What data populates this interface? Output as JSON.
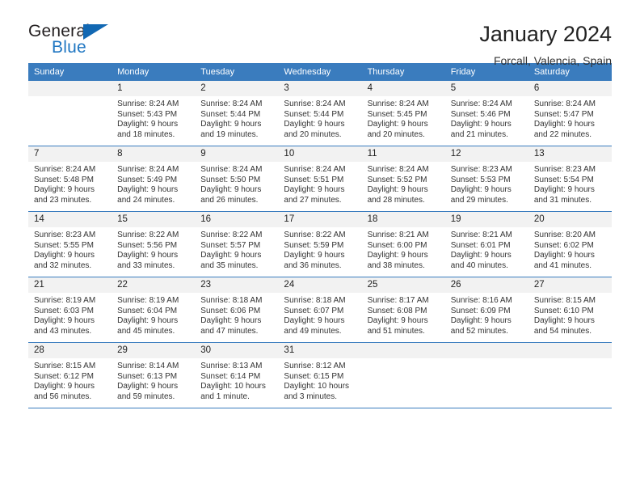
{
  "brand": {
    "name_part1": "General",
    "name_part2": "Blue",
    "flag_icon": "triangle-flag-icon"
  },
  "header": {
    "title": "January 2024",
    "subtitle": "Forcall, Valencia, Spain"
  },
  "colors": {
    "header_blue": "#3a7cbe",
    "brand_blue": "#1f76c2",
    "daynum_bg": "#f2f2f2",
    "text": "#333333"
  },
  "weekday_headers": [
    "Sunday",
    "Monday",
    "Tuesday",
    "Wednesday",
    "Thursday",
    "Friday",
    "Saturday"
  ],
  "weeks": [
    [
      {
        "day": "",
        "empty": true
      },
      {
        "day": "1",
        "sunrise": "Sunrise: 8:24 AM",
        "sunset": "Sunset: 5:43 PM",
        "daylight1": "Daylight: 9 hours",
        "daylight2": "and 18 minutes."
      },
      {
        "day": "2",
        "sunrise": "Sunrise: 8:24 AM",
        "sunset": "Sunset: 5:44 PM",
        "daylight1": "Daylight: 9 hours",
        "daylight2": "and 19 minutes."
      },
      {
        "day": "3",
        "sunrise": "Sunrise: 8:24 AM",
        "sunset": "Sunset: 5:44 PM",
        "daylight1": "Daylight: 9 hours",
        "daylight2": "and 20 minutes."
      },
      {
        "day": "4",
        "sunrise": "Sunrise: 8:24 AM",
        "sunset": "Sunset: 5:45 PM",
        "daylight1": "Daylight: 9 hours",
        "daylight2": "and 20 minutes."
      },
      {
        "day": "5",
        "sunrise": "Sunrise: 8:24 AM",
        "sunset": "Sunset: 5:46 PM",
        "daylight1": "Daylight: 9 hours",
        "daylight2": "and 21 minutes."
      },
      {
        "day": "6",
        "sunrise": "Sunrise: 8:24 AM",
        "sunset": "Sunset: 5:47 PM",
        "daylight1": "Daylight: 9 hours",
        "daylight2": "and 22 minutes."
      }
    ],
    [
      {
        "day": "7",
        "sunrise": "Sunrise: 8:24 AM",
        "sunset": "Sunset: 5:48 PM",
        "daylight1": "Daylight: 9 hours",
        "daylight2": "and 23 minutes."
      },
      {
        "day": "8",
        "sunrise": "Sunrise: 8:24 AM",
        "sunset": "Sunset: 5:49 PM",
        "daylight1": "Daylight: 9 hours",
        "daylight2": "and 24 minutes."
      },
      {
        "day": "9",
        "sunrise": "Sunrise: 8:24 AM",
        "sunset": "Sunset: 5:50 PM",
        "daylight1": "Daylight: 9 hours",
        "daylight2": "and 26 minutes."
      },
      {
        "day": "10",
        "sunrise": "Sunrise: 8:24 AM",
        "sunset": "Sunset: 5:51 PM",
        "daylight1": "Daylight: 9 hours",
        "daylight2": "and 27 minutes."
      },
      {
        "day": "11",
        "sunrise": "Sunrise: 8:24 AM",
        "sunset": "Sunset: 5:52 PM",
        "daylight1": "Daylight: 9 hours",
        "daylight2": "and 28 minutes."
      },
      {
        "day": "12",
        "sunrise": "Sunrise: 8:23 AM",
        "sunset": "Sunset: 5:53 PM",
        "daylight1": "Daylight: 9 hours",
        "daylight2": "and 29 minutes."
      },
      {
        "day": "13",
        "sunrise": "Sunrise: 8:23 AM",
        "sunset": "Sunset: 5:54 PM",
        "daylight1": "Daylight: 9 hours",
        "daylight2": "and 31 minutes."
      }
    ],
    [
      {
        "day": "14",
        "sunrise": "Sunrise: 8:23 AM",
        "sunset": "Sunset: 5:55 PM",
        "daylight1": "Daylight: 9 hours",
        "daylight2": "and 32 minutes."
      },
      {
        "day": "15",
        "sunrise": "Sunrise: 8:22 AM",
        "sunset": "Sunset: 5:56 PM",
        "daylight1": "Daylight: 9 hours",
        "daylight2": "and 33 minutes."
      },
      {
        "day": "16",
        "sunrise": "Sunrise: 8:22 AM",
        "sunset": "Sunset: 5:57 PM",
        "daylight1": "Daylight: 9 hours",
        "daylight2": "and 35 minutes."
      },
      {
        "day": "17",
        "sunrise": "Sunrise: 8:22 AM",
        "sunset": "Sunset: 5:59 PM",
        "daylight1": "Daylight: 9 hours",
        "daylight2": "and 36 minutes."
      },
      {
        "day": "18",
        "sunrise": "Sunrise: 8:21 AM",
        "sunset": "Sunset: 6:00 PM",
        "daylight1": "Daylight: 9 hours",
        "daylight2": "and 38 minutes."
      },
      {
        "day": "19",
        "sunrise": "Sunrise: 8:21 AM",
        "sunset": "Sunset: 6:01 PM",
        "daylight1": "Daylight: 9 hours",
        "daylight2": "and 40 minutes."
      },
      {
        "day": "20",
        "sunrise": "Sunrise: 8:20 AM",
        "sunset": "Sunset: 6:02 PM",
        "daylight1": "Daylight: 9 hours",
        "daylight2": "and 41 minutes."
      }
    ],
    [
      {
        "day": "21",
        "sunrise": "Sunrise: 8:19 AM",
        "sunset": "Sunset: 6:03 PM",
        "daylight1": "Daylight: 9 hours",
        "daylight2": "and 43 minutes."
      },
      {
        "day": "22",
        "sunrise": "Sunrise: 8:19 AM",
        "sunset": "Sunset: 6:04 PM",
        "daylight1": "Daylight: 9 hours",
        "daylight2": "and 45 minutes."
      },
      {
        "day": "23",
        "sunrise": "Sunrise: 8:18 AM",
        "sunset": "Sunset: 6:06 PM",
        "daylight1": "Daylight: 9 hours",
        "daylight2": "and 47 minutes."
      },
      {
        "day": "24",
        "sunrise": "Sunrise: 8:18 AM",
        "sunset": "Sunset: 6:07 PM",
        "daylight1": "Daylight: 9 hours",
        "daylight2": "and 49 minutes."
      },
      {
        "day": "25",
        "sunrise": "Sunrise: 8:17 AM",
        "sunset": "Sunset: 6:08 PM",
        "daylight1": "Daylight: 9 hours",
        "daylight2": "and 51 minutes."
      },
      {
        "day": "26",
        "sunrise": "Sunrise: 8:16 AM",
        "sunset": "Sunset: 6:09 PM",
        "daylight1": "Daylight: 9 hours",
        "daylight2": "and 52 minutes."
      },
      {
        "day": "27",
        "sunrise": "Sunrise: 8:15 AM",
        "sunset": "Sunset: 6:10 PM",
        "daylight1": "Daylight: 9 hours",
        "daylight2": "and 54 minutes."
      }
    ],
    [
      {
        "day": "28",
        "sunrise": "Sunrise: 8:15 AM",
        "sunset": "Sunset: 6:12 PM",
        "daylight1": "Daylight: 9 hours",
        "daylight2": "and 56 minutes."
      },
      {
        "day": "29",
        "sunrise": "Sunrise: 8:14 AM",
        "sunset": "Sunset: 6:13 PM",
        "daylight1": "Daylight: 9 hours",
        "daylight2": "and 59 minutes."
      },
      {
        "day": "30",
        "sunrise": "Sunrise: 8:13 AM",
        "sunset": "Sunset: 6:14 PM",
        "daylight1": "Daylight: 10 hours",
        "daylight2": "and 1 minute."
      },
      {
        "day": "31",
        "sunrise": "Sunrise: 8:12 AM",
        "sunset": "Sunset: 6:15 PM",
        "daylight1": "Daylight: 10 hours",
        "daylight2": "and 3 minutes."
      },
      {
        "day": "",
        "empty": true
      },
      {
        "day": "",
        "empty": true
      },
      {
        "day": "",
        "empty": true
      }
    ]
  ]
}
